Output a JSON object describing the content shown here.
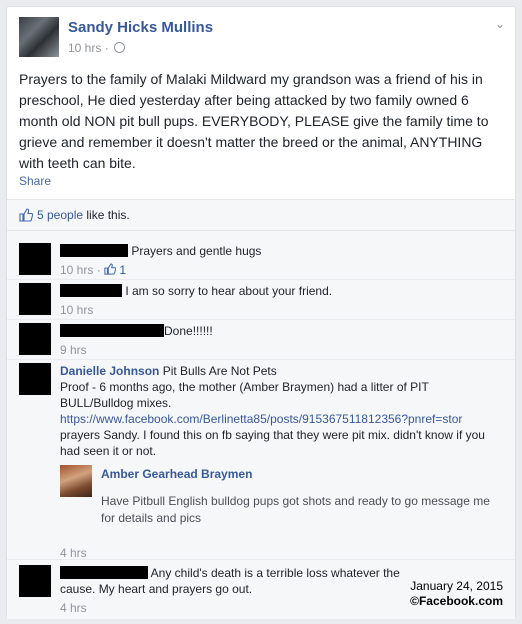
{
  "post": {
    "author": "Sandy Hicks Mullins",
    "time": "10 hrs",
    "text": "Prayers to the family of Malaki Mildward my grandson was a friend of his in preschool, He died yesterday after being attacked by two family owned 6 month old NON pit bull pups. EVERYBODY, PLEASE give the family time to grieve and remember it doesn't matter the breed or the animal, ANYTHING with teeth can bite.",
    "share_label": "Share"
  },
  "likes": {
    "count": "5 people",
    "suffix": " like this."
  },
  "comments": [
    {
      "text": "Prayers and gentle hugs",
      "time": "10 hrs",
      "like_count": "1"
    },
    {
      "text": "I am so sorry to hear about your friend.",
      "time": "10 hrs"
    },
    {
      "text": "Done!!!!!!",
      "time": "9 hrs"
    },
    {
      "author": "Danielle Johnson",
      "text1": "Pit Bulls Are Not Pets",
      "text2": "Proof - 6 months ago, the mother (Amber Braymen) had a litter of PIT BULL/Bulldog mixes.",
      "link": "https://www.facebook.com/Berlinetta85/posts/915367511812356?pnref=stor",
      "text3": "prayers Sandy. I found this on fb saying that they were pit mix. didn't know if you had seen it or not.",
      "preview": {
        "name": "Amber Gearhead Braymen",
        "text": "Have Pitbull English bulldog pups got shots and ready to go message me for details and pics"
      },
      "time": "4 hrs"
    },
    {
      "text": "Any child's death is a terrible loss whatever the cause. My heart and prayers go out.",
      "time": "4 hrs"
    }
  ],
  "stamp": {
    "date": "January 24, 2015",
    "credit": "©Facebook.com"
  },
  "colors": {
    "link": "#365899",
    "meta": "#90949c",
    "text": "#1d2129"
  }
}
